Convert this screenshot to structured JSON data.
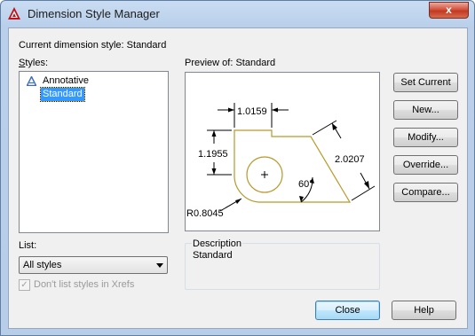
{
  "window": {
    "title": "Dimension Style Manager",
    "close_glyph": "x"
  },
  "current_style": {
    "label": "Current dimension style:",
    "value": "Standard"
  },
  "styles": {
    "label": "Styles:",
    "items": [
      {
        "label": "Annotative",
        "icon": "annotative-icon",
        "selected": false
      },
      {
        "label": "Standard",
        "selected": true
      }
    ]
  },
  "preview": {
    "label": "Preview of: Standard",
    "dims": {
      "top": "1.0159",
      "left": "1.1955",
      "right": "2.0207",
      "angle": "60°",
      "radius": "R0.8045"
    }
  },
  "list": {
    "label": "List:",
    "selected": "All styles"
  },
  "xrefs_checkbox": {
    "label": "Don't list styles in Xrefs",
    "checked": true,
    "enabled": false
  },
  "description": {
    "label": "Description",
    "text": "Standard"
  },
  "buttons": {
    "set_current": "Set Current",
    "new": "New...",
    "modify": "Modify...",
    "override": "Override...",
    "compare": "Compare...",
    "close": "Close",
    "help": "Help"
  },
  "colors": {
    "preview_outline": "#b59a2a",
    "selection": "#3399ff",
    "annotative_icon": "#3d6cb8"
  }
}
